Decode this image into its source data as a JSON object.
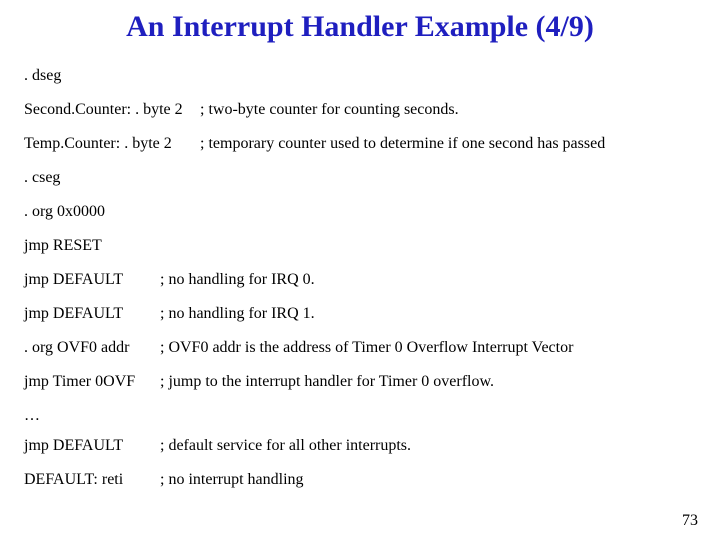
{
  "title": "An Interrupt Handler Example (4/9)",
  "lines": {
    "dseg": ". dseg",
    "second_counter_decl": "Second.Counter: . byte 2",
    "second_counter_comment": "; two-byte counter for counting seconds.",
    "temp_counter_decl": "Temp.Counter: . byte 2",
    "temp_counter_comment": "; temporary counter used to determine if one second has passed",
    "cseg": ". cseg",
    "org0": ". org 0x0000",
    "jmp_reset": "jmp RESET",
    "jmp_default_irq0": "jmp DEFAULT",
    "jmp_default_irq0_comment": "; no handling for IRQ 0.",
    "jmp_default_irq1": "jmp DEFAULT",
    "jmp_default_irq1_comment": "; no handling for IRQ 1.",
    "org_ovf0": ". org OVF0 addr",
    "org_ovf0_comment": "; OVF0 addr is the address of Timer 0 Overflow Interrupt Vector",
    "jmp_timer0ovf": "jmp Timer 0OVF",
    "jmp_timer0ovf_comment": "; jump to the interrupt handler for Timer 0 overflow.",
    "ellipsis": "…",
    "jmp_default_all": "jmp DEFAULT",
    "jmp_default_all_comment": "; default service for all other interrupts.",
    "default_reti": "DEFAULT: reti",
    "default_reti_comment": "; no interrupt handling"
  },
  "page_number": "73"
}
